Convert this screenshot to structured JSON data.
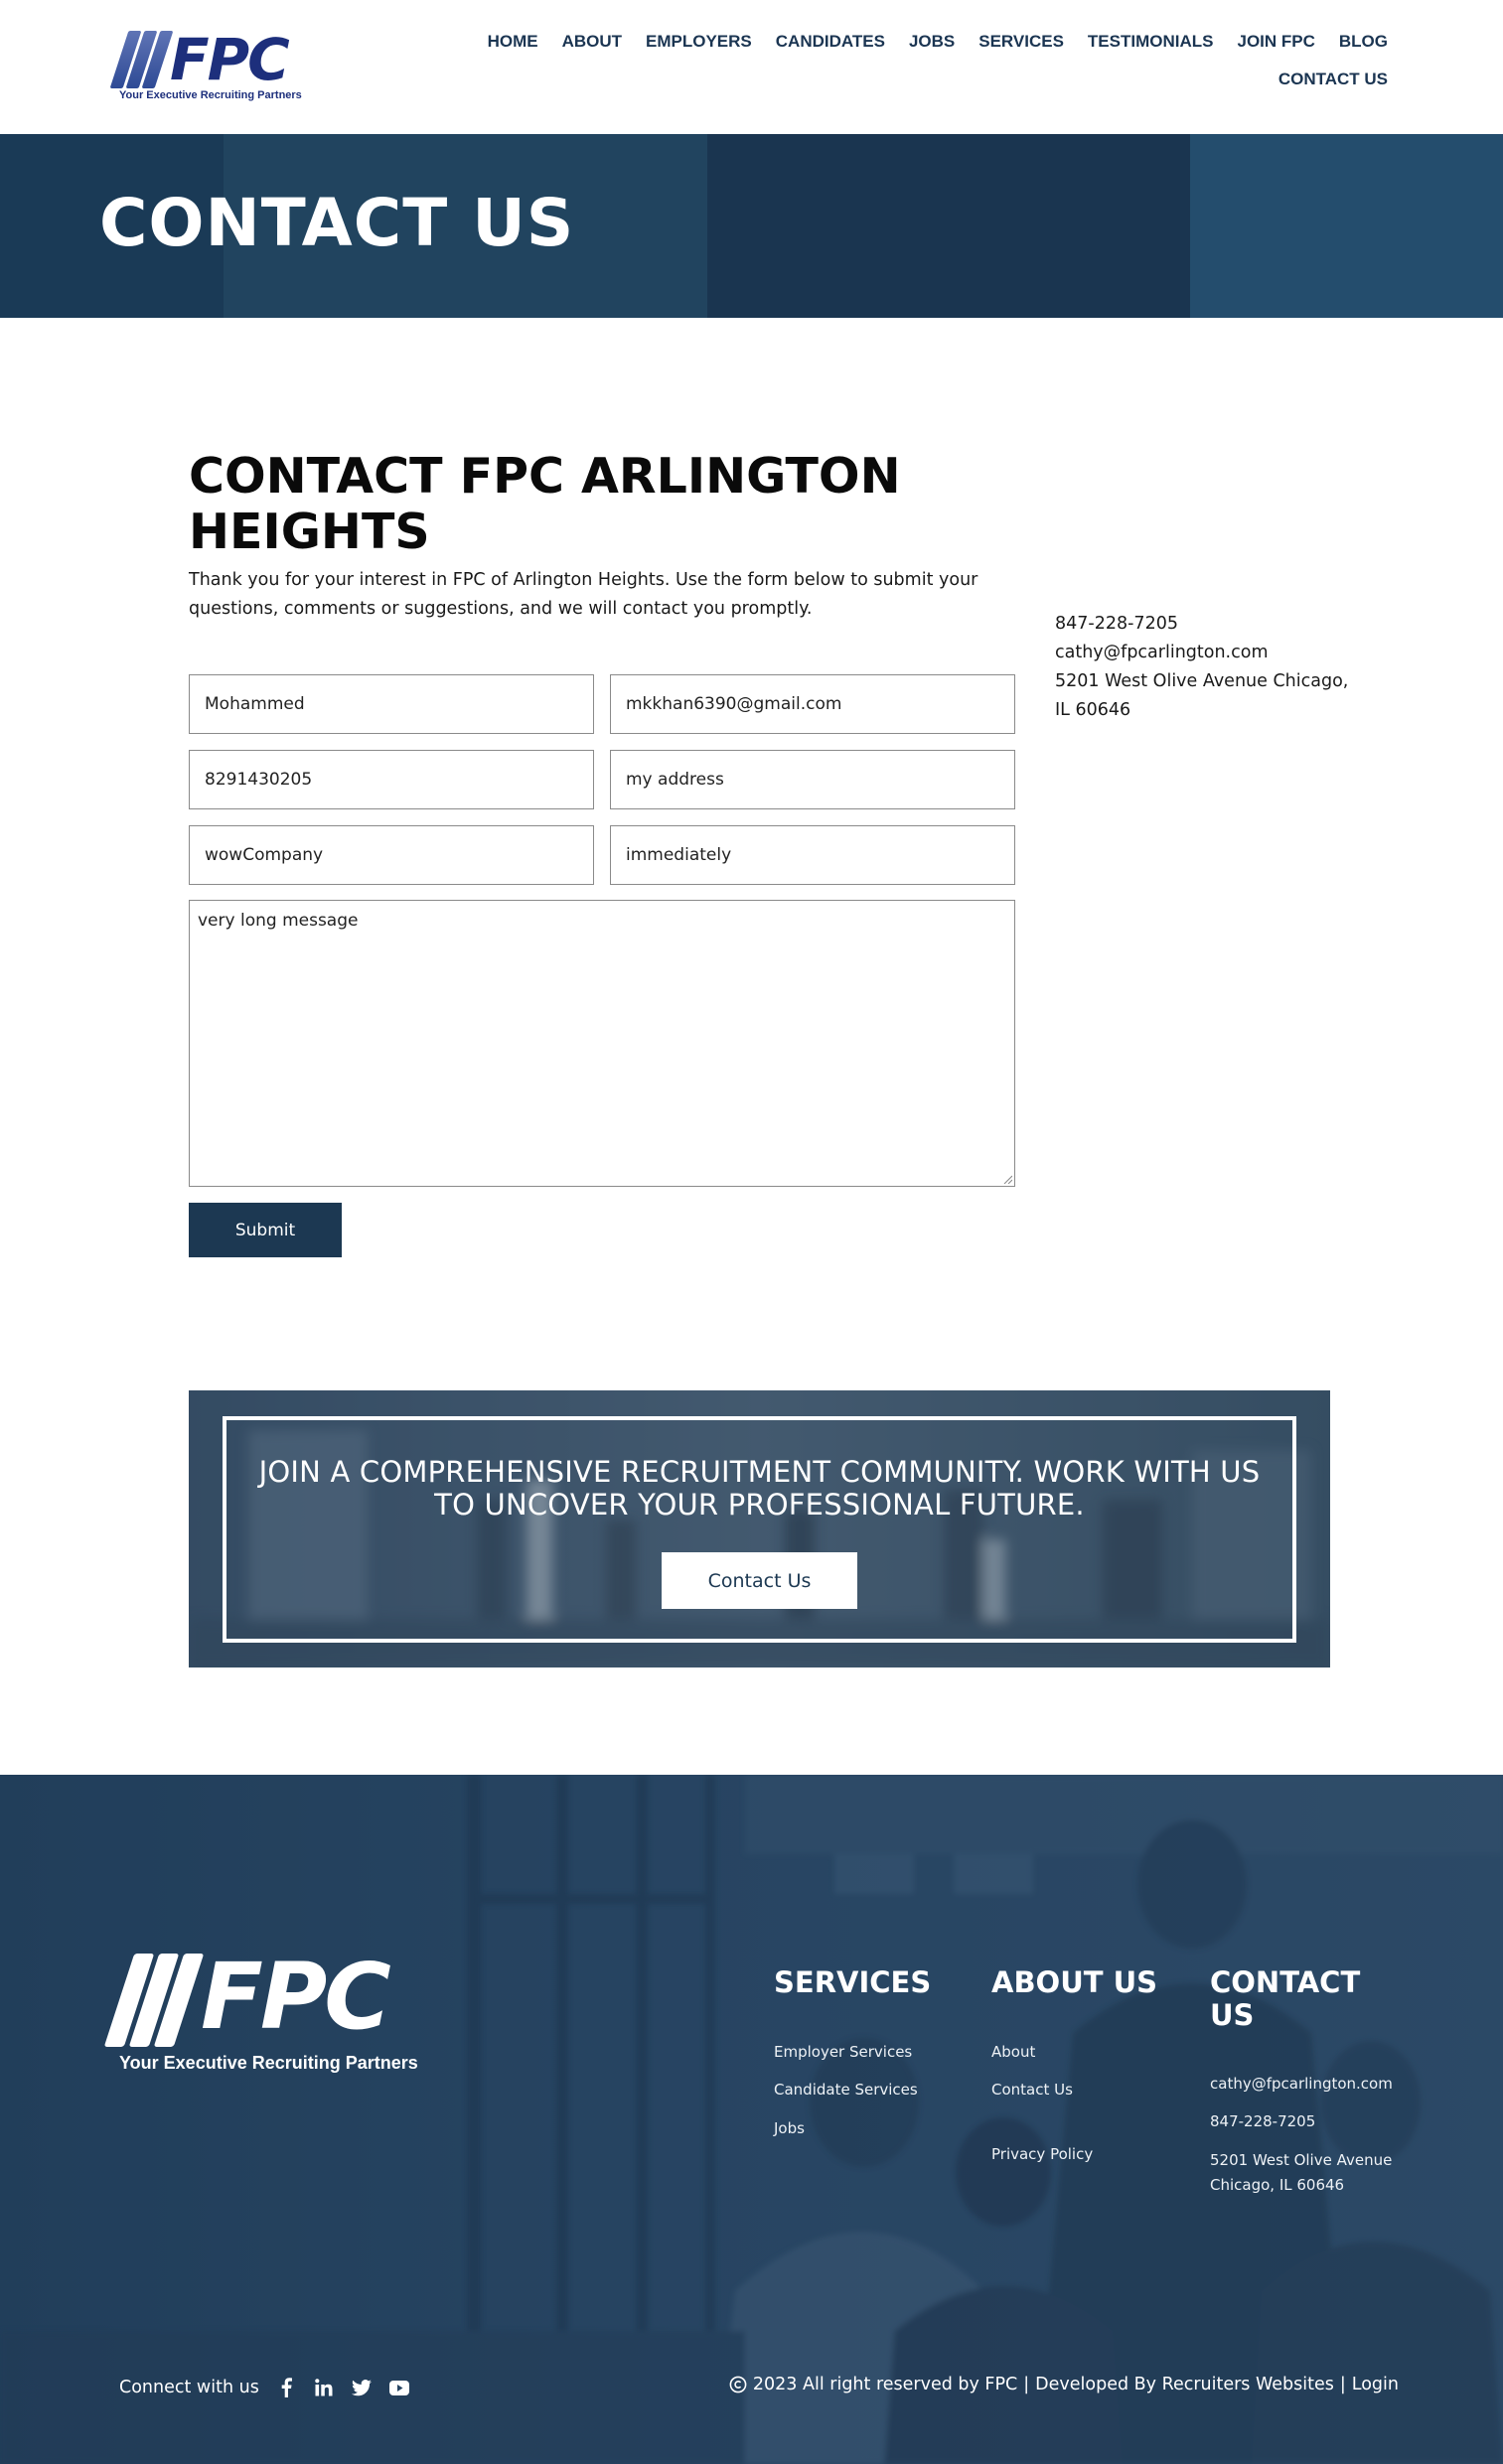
{
  "brand": {
    "logo_word": "FPC",
    "tagline": "Your Executive Recruiting Partners"
  },
  "nav": {
    "items": [
      {
        "label": "HOME"
      },
      {
        "label": "ABOUT"
      },
      {
        "label": "EMPLOYERS"
      },
      {
        "label": "CANDIDATES"
      },
      {
        "label": "JOBS"
      },
      {
        "label": "SERVICES"
      },
      {
        "label": "TESTIMONIALS"
      },
      {
        "label": "JOIN FPC"
      },
      {
        "label": "BLOG"
      }
    ],
    "contact_label": "CONTACT US"
  },
  "hero": {
    "title": "CONTACT US"
  },
  "contact": {
    "title": "CONTACT FPC ARLINGTON HEIGHTS",
    "intro": "Thank you for your interest in FPC of Arlington Heights. Use the form below to submit your questions, comments or suggestions, and we will contact you promptly.",
    "phone": "847-228-7205",
    "email": "cathy@fpcarlington.com",
    "address_line1": "5201 West Olive Avenue Chicago,",
    "address_line2": "IL 60646"
  },
  "form": {
    "name": "Mohammed",
    "email": "mkkhan6390@gmail.com",
    "phone": "8291430205",
    "address": "my address",
    "company": "wowCompany",
    "timeline": "immediately",
    "message": "very long message",
    "submit_label": "Submit"
  },
  "cta": {
    "heading": "JOIN A COMPREHENSIVE RECRUITMENT COMMUNITY. WORK WITH US TO UNCOVER YOUR PROFESSIONAL FUTURE.",
    "button_label": "Contact Us"
  },
  "footer": {
    "services": {
      "title": "SERVICES",
      "links": [
        "Employer Services",
        "Candidate Services",
        "Jobs"
      ]
    },
    "about": {
      "title": "ABOUT US",
      "links": [
        "About",
        "Contact Us",
        "Privacy Policy"
      ]
    },
    "contact": {
      "title": "CONTACT US",
      "email": "cathy@fpcarlington.com",
      "phone": "847-228-7205",
      "address_line1": "5201 West Olive Avenue",
      "address_line2": "Chicago, IL 60646"
    },
    "connect_label": "Connect with us",
    "social_icons": [
      "facebook-icon",
      "linkedin-icon",
      "twitter-icon",
      "youtube-icon"
    ],
    "copyright": "2023 All right reserved by FPC",
    "separator": "|",
    "developed_by": "Developed By Recruiters Websites",
    "login_label": "Login"
  },
  "colors": {
    "navy": "#1c3852",
    "nav_text": "#1b3552",
    "logo_blue": "#1d2f7c",
    "hero_bg": "#1d3e5a",
    "footer_bg": "#274563"
  }
}
